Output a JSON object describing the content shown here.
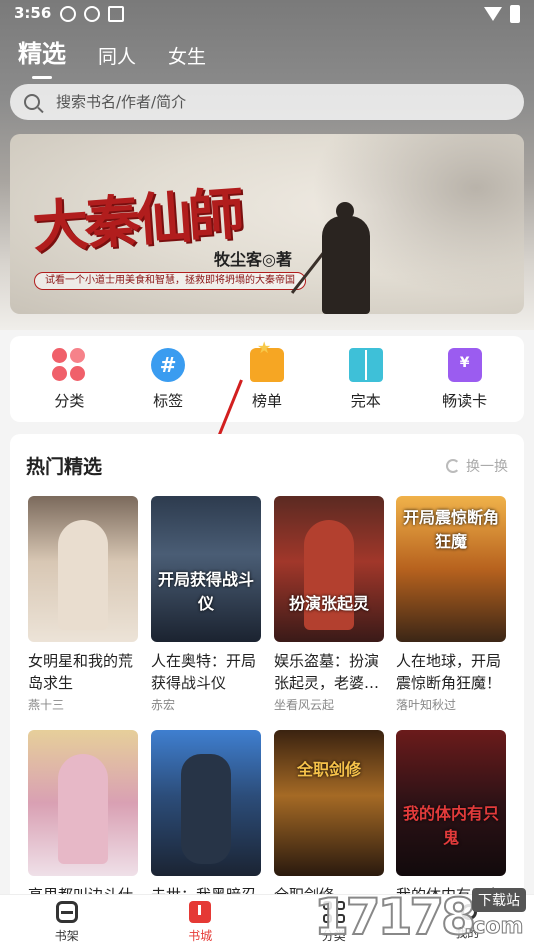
{
  "status_bar": {
    "time": "3:56"
  },
  "top_tabs": [
    {
      "label": "精选",
      "active": true
    },
    {
      "label": "同人",
      "active": false
    },
    {
      "label": "女生",
      "active": false
    }
  ],
  "search": {
    "placeholder": "搜索书名/作者/简介"
  },
  "banner": {
    "title": "大秦仙師",
    "author": "牧尘客◎著",
    "slogan": "试看一个小道士用美食和智慧，拯救即将坍塌的大秦帝国"
  },
  "categories": [
    {
      "label": "分类",
      "icon": "flower-icon"
    },
    {
      "label": "标签",
      "icon": "hashtag-icon"
    },
    {
      "label": "榜单",
      "icon": "trophy-icon"
    },
    {
      "label": "完本",
      "icon": "book-icon"
    },
    {
      "label": "畅读卡",
      "icon": "ticket-icon",
      "icon_text": "¥"
    }
  ],
  "hot_section": {
    "title": "热门精选",
    "refresh_label": "换一换",
    "books": [
      {
        "title": "女明星和我的荒岛求生",
        "author": "燕十三",
        "cover_text": ""
      },
      {
        "title": "人在奥特：开局获得战斗仪",
        "author": "赤宏",
        "cover_text": "开局获得战斗仪"
      },
      {
        "title": "娱乐盗墓：扮演张起灵，老婆…",
        "author": "坐看风云起",
        "cover_text": "扮演张起灵"
      },
      {
        "title": "人在地球，开局震惊断角狂魔！",
        "author": "落叶知秋过",
        "cover_text": "开局震惊断角狂魔"
      },
      {
        "title": "高里都叫边斗仕",
        "author": "",
        "cover_text": ""
      },
      {
        "title": "未世：我黑暗忍",
        "author": "",
        "cover_text": ""
      },
      {
        "title": "全职剑修",
        "author": "",
        "cover_text": "全职剑修"
      },
      {
        "title": "我的体内有只鬼",
        "author": "",
        "cover_text": "我的体内有只鬼"
      }
    ]
  },
  "bottom_nav": [
    {
      "label": "书架",
      "active": false
    },
    {
      "label": "书城",
      "active": true
    },
    {
      "label": "分类",
      "active": false
    },
    {
      "label": "我的",
      "active": false
    }
  ],
  "watermark": {
    "number": "17178",
    "badge": "下载站",
    "domain": ".com"
  },
  "colors": {
    "accent": "#e53935",
    "banner_red": "#b11d1d"
  }
}
